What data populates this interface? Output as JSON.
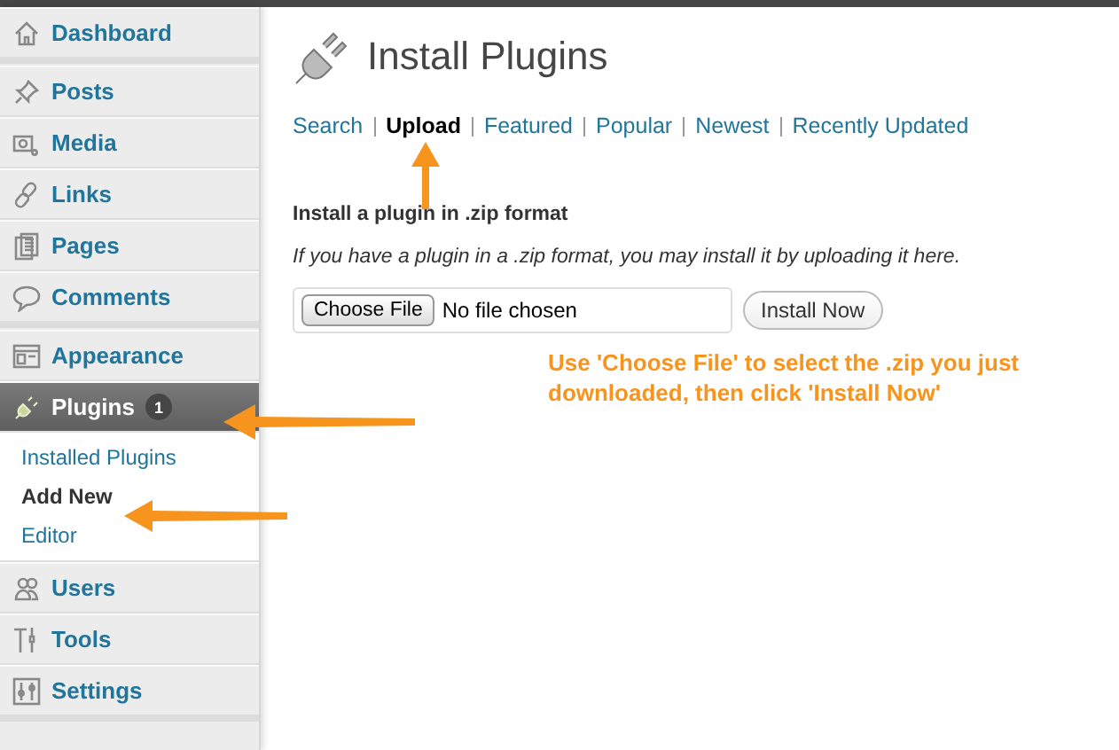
{
  "sidebar": {
    "groups": [
      [
        {
          "label": "Dashboard",
          "selected": false
        }
      ],
      [
        {
          "label": "Posts",
          "selected": false
        },
        {
          "label": "Media",
          "selected": false
        },
        {
          "label": "Links",
          "selected": false
        },
        {
          "label": "Pages",
          "selected": false
        },
        {
          "label": "Comments",
          "selected": false
        }
      ],
      [
        {
          "label": "Appearance",
          "selected": false
        },
        {
          "label": "Plugins",
          "selected": true,
          "badge": "1",
          "submenu": [
            {
              "label": "Installed Plugins",
              "selected": false
            },
            {
              "label": "Add New",
              "selected": true
            },
            {
              "label": "Editor",
              "selected": false
            }
          ]
        },
        {
          "label": "Users",
          "selected": false
        },
        {
          "label": "Tools",
          "selected": false
        },
        {
          "label": "Settings",
          "selected": false
        }
      ]
    ]
  },
  "page": {
    "title": "Install Plugins",
    "tabs": [
      {
        "label": "Search",
        "selected": false
      },
      {
        "label": "Upload",
        "selected": true
      },
      {
        "label": "Featured",
        "selected": false
      },
      {
        "label": "Popular",
        "selected": false
      },
      {
        "label": "Newest",
        "selected": false
      },
      {
        "label": "Recently Updated",
        "selected": false
      }
    ],
    "section_title": "Install a plugin in .zip format",
    "description": "If you have a plugin in a .zip format, you may install it by uploading it here.",
    "file_button": "Choose File",
    "file_status": "No file chosen",
    "submit_button": "Install Now"
  },
  "annotation": "Use 'Choose File' to select the .zip you just downloaded, then click 'Install Now'"
}
